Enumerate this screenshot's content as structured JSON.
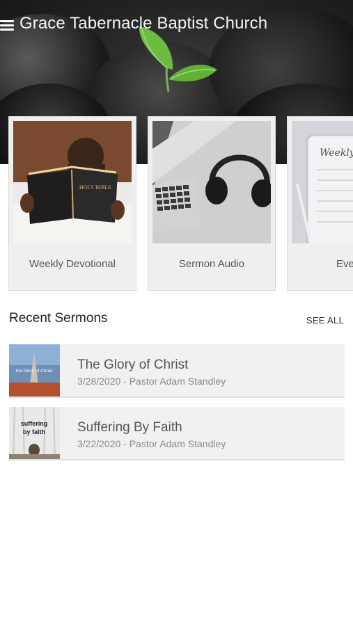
{
  "header": {
    "title": "Grace Tabernacle Baptist Church",
    "menu_icon": "hamburger-menu-icon",
    "background_image": "dark rocks with green sprout"
  },
  "cards": [
    {
      "label": "Weekly Devotional",
      "image": "child reading holy bible",
      "thumb_text": "HOLY BIBLE"
    },
    {
      "label": "Sermon Audio",
      "image": "laptop and headphones"
    },
    {
      "label": "Ever",
      "image": "tablet with weekly planner",
      "thumb_text": "Weekly"
    }
  ],
  "recent_sermons": {
    "title": "Recent Sermons",
    "see_all": "SEE ALL",
    "items": [
      {
        "title": "The Glory of Christ",
        "meta": "3/28/2020 - Pastor Adam Standley",
        "thumb_text": "the Glory of Christ"
      },
      {
        "title": "Suffering By Faith",
        "meta": "3/22/2020 - Pastor Adam Standley",
        "thumb_text": "suffering by faith"
      }
    ]
  },
  "colors": {
    "header_text": "#f4f4f4",
    "card_bg": "#efefef",
    "list_bg": "#f1f1f1",
    "meta_text": "#8a8a8a",
    "sprout": "#6dbb3f"
  }
}
